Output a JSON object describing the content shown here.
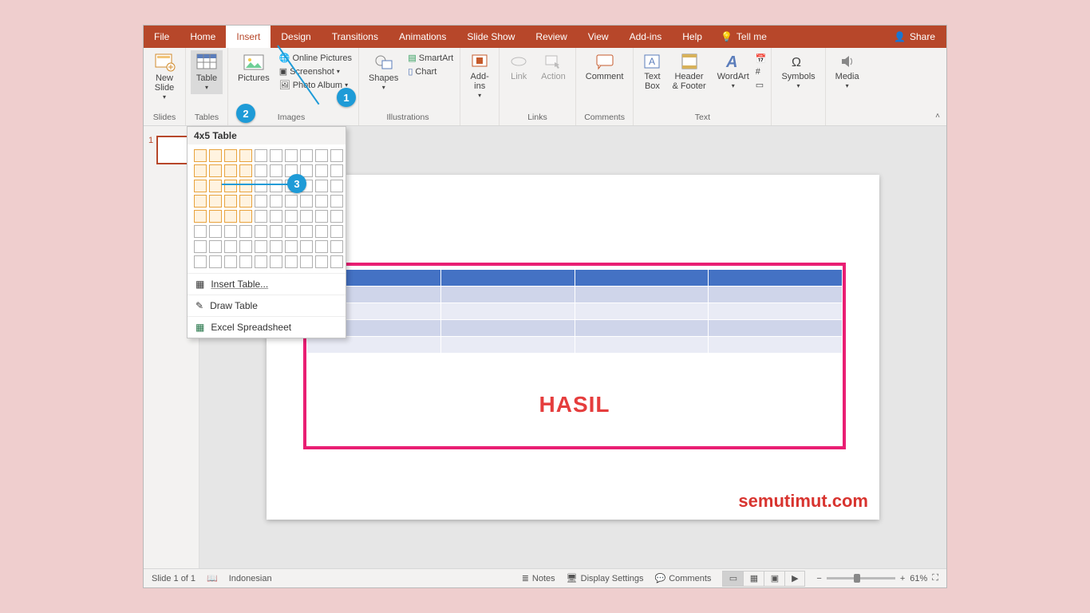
{
  "tabs": {
    "file": "File",
    "home": "Home",
    "insert": "Insert",
    "design": "Design",
    "transitions": "Transitions",
    "animations": "Animations",
    "slideshow": "Slide Show",
    "review": "Review",
    "view": "View",
    "addins": "Add-ins",
    "help": "Help",
    "tellme": "Tell me",
    "share": "Share"
  },
  "ribbon": {
    "slides": {
      "label": "Slides",
      "newslide": "New\nSlide"
    },
    "tables": {
      "label": "Tables",
      "table": "Table"
    },
    "images": {
      "label": "Images",
      "pictures": "Pictures",
      "online": "Online Pictures",
      "screenshot": "Screenshot",
      "album": "Photo Album"
    },
    "illus": {
      "label": "Illustrations",
      "shapes": "Shapes",
      "smartart": "SmartArt",
      "chart": "Chart"
    },
    "addins": {
      "label": "Add-ins",
      "addins_btn": "Add-\nins"
    },
    "links": {
      "label": "Links",
      "link": "Link",
      "action": "Action"
    },
    "comments": {
      "label": "Comments",
      "comment": "Comment"
    },
    "text": {
      "label": "Text",
      "textbox": "Text\nBox",
      "header": "Header\n& Footer",
      "wordart": "WordArt"
    },
    "symbols": {
      "label": "",
      "symbols": "Symbols"
    },
    "media": {
      "label": "",
      "media": "Media"
    }
  },
  "dropdown": {
    "title": "4x5 Table",
    "cols": 10,
    "rows": 8,
    "selCols": 4,
    "selRows": 5,
    "insert": "Insert Table...",
    "draw": "Draw Table",
    "excel": "Excel Spreadsheet"
  },
  "markers": {
    "m1": "1",
    "m2": "2",
    "m3": "3"
  },
  "slide": {
    "hasil": "HASIL"
  },
  "watermark": "semutimut.com",
  "status": {
    "slide": "Slide 1 of 1",
    "lang": "Indonesian",
    "notes": "Notes",
    "display": "Display Settings",
    "comments": "Comments",
    "zoom": "61%"
  },
  "thumb": {
    "n": "1"
  }
}
